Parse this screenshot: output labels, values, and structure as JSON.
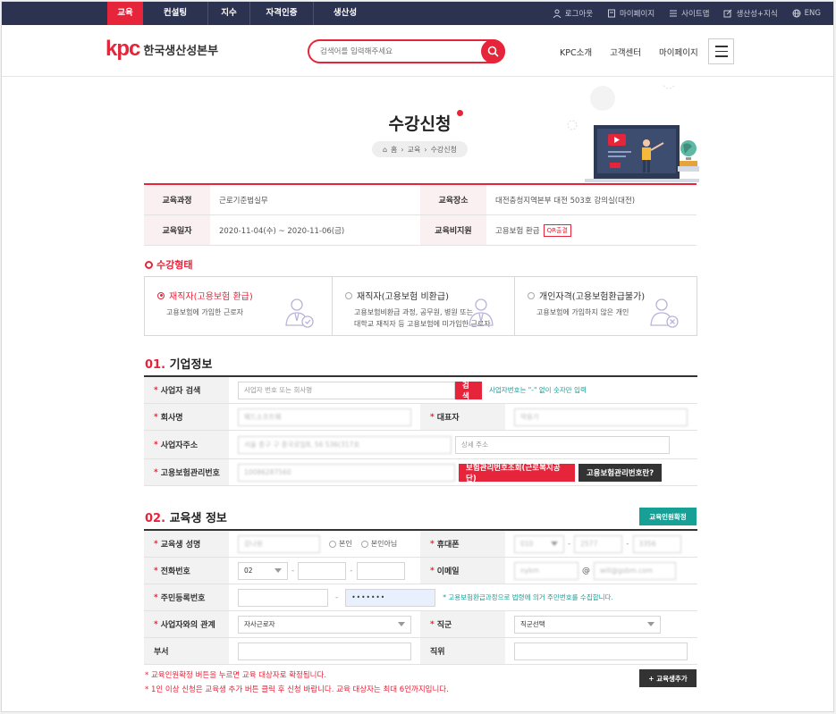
{
  "topnav": [
    "교육",
    "컨설팅",
    "지수",
    "자격인증",
    "생산성"
  ],
  "toputil": [
    "로그아웃",
    "마이페이지",
    "사이트맵",
    "생산성+지식",
    "ENG"
  ],
  "logo": {
    "mark": "kpc",
    "org": "한국생산성본부"
  },
  "search": {
    "placeholder": "검색어를 입력해주세요"
  },
  "header_menu": [
    "KPC소개",
    "고객센터",
    "마이페이지"
  ],
  "page": {
    "title": "수강신청",
    "breadcrumb": [
      "홈",
      "교육",
      "수강신청"
    ]
  },
  "course_info": {
    "course_label": "교육과정",
    "course_value": "근로기준법실무",
    "place_label": "교육장소",
    "place_value": "대전충청지역본부 대전 503호 강의실(대전)",
    "date_label": "교육일자",
    "date_value": "2020-11-04(수) ~ 2020-11-06(금)",
    "support_label": "교육비지원",
    "support_value": "고용보험 환급",
    "support_badge": "QR출결"
  },
  "attend_type": {
    "heading": "수강형태",
    "options": [
      {
        "title": "재직자(고용보험 환급)",
        "desc1": "고용보험에 가입한 근로자",
        "desc2": ""
      },
      {
        "title": "재직자(고용보험 비환급)",
        "desc1": "고용보험비환급 과정, 공무원, 병원 또는",
        "desc2": "대학교 재직자 등 고용보험에 미가입한 근로자"
      },
      {
        "title": "개인자격(고용보험환급불가)",
        "desc1": "고용보험에 가입하지 않은 개인",
        "desc2": ""
      }
    ]
  },
  "company": {
    "num": "01.",
    "heading": "기업정보",
    "biz_search_label": "사업자 검색",
    "biz_search_placeholder": "사업자 번호 또는 회사명",
    "search_btn": "검색",
    "biz_hint": "사업자번호는 \"-\" 없이 숫자만 입력",
    "name_label": "회사명",
    "name_value": "웨드소프트웨",
    "ceo_label": "대표자",
    "ceo_value": "약용기",
    "addr_label": "사업자주소",
    "addr_value": "서울 중구 구 중국로일8, 56 536(317호",
    "addr_detail_placeholder": "상세 주소",
    "ins_label": "고용보험관리번호",
    "ins_value": "10086287560",
    "ins_btn1": "보험관리번호조회(근로복지공단)",
    "ins_btn2": "고용보험관리번호란?"
  },
  "student": {
    "num": "02.",
    "heading": "교육생 정보",
    "confirm_btn": "교육인원확정",
    "name_label": "교육생 성명",
    "name_value": "강나원",
    "self_opt": "본인",
    "not_self_opt": "본인아님",
    "mobile_label": "휴대폰",
    "mobile": [
      "010",
      "2577",
      "3356"
    ],
    "phone_label": "전화번호",
    "phone_area": "02",
    "email_label": "이메일",
    "email_id": "nykm",
    "email_at": "@",
    "email_domain": "will@gsbm.com",
    "rrn_label": "주민등록번호",
    "rrn_back": "•••••••",
    "rrn_hint": "* 고용보험환급과정으로 법령에 의거 주민번호를 수집합니다.",
    "relation_label": "사업자와의 관계",
    "relation_value": "자사근로자",
    "rank_label": "직군",
    "rank_value": "직군선택",
    "dept_label": "부서",
    "pos_label": "직위",
    "add_btn": "+ 교육생추가"
  },
  "notes": [
    "* 교육인원확정 버튼을 누르면 교육 대상자로 확정됩니다.",
    "* 1인 이상 신청은 교육생 추가 버튼 클릭 후 신청 바랍니다. 교육 대상자는 최대 6인까지입니다."
  ],
  "colors": {
    "accent": "#e6243a",
    "navy": "#2b3350",
    "teal": "#17a096"
  }
}
